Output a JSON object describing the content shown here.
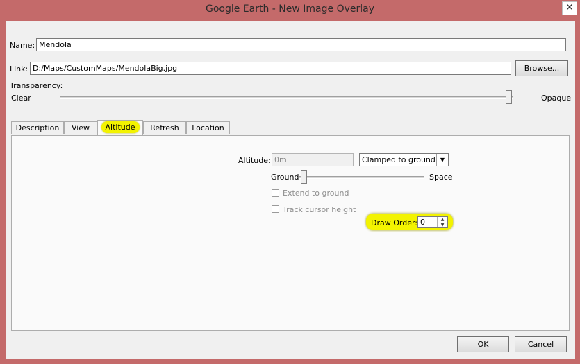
{
  "window": {
    "title": "Google Earth - New Image Overlay",
    "close_glyph": "✕"
  },
  "form": {
    "name_label": "Name:",
    "name_value": "Mendola",
    "link_label": "Link:",
    "link_value": "D:/Maps/CustomMaps/MendolaBig.jpg",
    "browse_label": "Browse...",
    "transparency_label": "Transparency:",
    "transparency_min": "Clear",
    "transparency_max": "Opaque",
    "transparency_level": 1.0
  },
  "tabs": [
    {
      "label": "Description"
    },
    {
      "label": "View"
    },
    {
      "label": "Altitude",
      "active": true
    },
    {
      "label": "Refresh"
    },
    {
      "label": "Location"
    }
  ],
  "altitude_tab": {
    "altitude_label": "Altitude:",
    "altitude_placeholder": "0m",
    "mode_value": "Clamped to ground",
    "slider_min": "Ground",
    "slider_max": "Space",
    "slider_level": 0.0,
    "extend_label": "Extend to ground",
    "extend_checked": false,
    "track_label": "Track cursor height",
    "track_checked": false,
    "draw_order_label": "Draw Order:",
    "draw_order_value": "0"
  },
  "footer": {
    "ok_label": "OK",
    "cancel_label": "Cancel"
  },
  "colors": {
    "frame": "#c46a6a",
    "highlight": "#f3f300",
    "client": "#f0f0f0"
  },
  "icons": {
    "close": "close-icon",
    "dropdown": "chevron-down-icon",
    "spinner": "spinner-arrows-icon"
  }
}
